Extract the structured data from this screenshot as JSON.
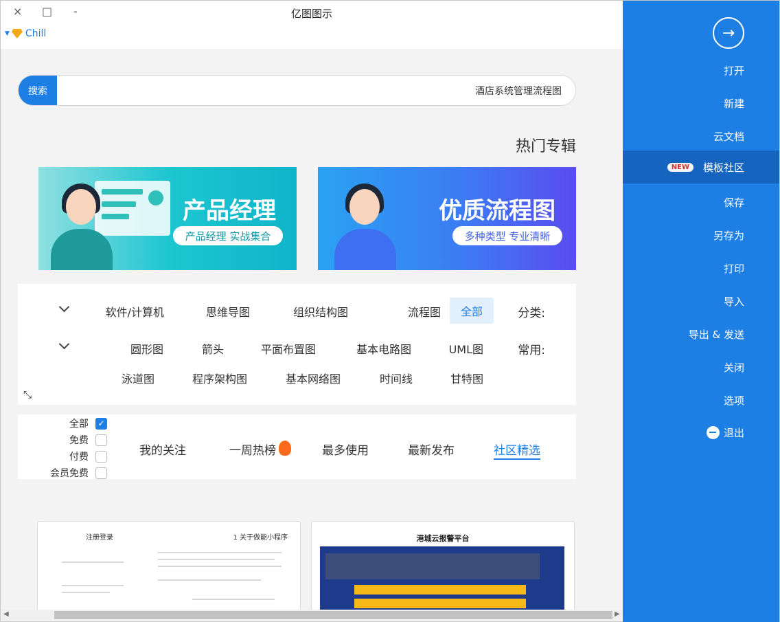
{
  "window": {
    "title": "亿图图示",
    "close_icon": "×",
    "maximize_icon": "□",
    "minimize_icon": "-"
  },
  "user": {
    "name": "Chill"
  },
  "search": {
    "button_label": "搜索",
    "query": "酒店系统管理流程图"
  },
  "hot": {
    "title": "热门专辑",
    "banners": [
      {
        "title": "产品经理",
        "subtitle": "产品经理 实战集合"
      },
      {
        "title": "优质流程图",
        "subtitle": "多种类型 专业清晰"
      }
    ]
  },
  "filters": {
    "category_label": "分类:",
    "categories": [
      "全部",
      "流程图",
      "组织结构图",
      "思维导图",
      "软件/计算机"
    ],
    "common_label": "常用:",
    "common_row1": [
      "UML图",
      "基本电路图",
      "平面布置图",
      "箭头",
      "圆形图"
    ],
    "common_row2": [
      "甘特图",
      "时间线",
      "基本网络图",
      "程序架构图",
      "泳道图"
    ],
    "expand_icon": "⤡"
  },
  "tabs": {
    "items": [
      "社区精选",
      "最新发布",
      "最多使用",
      "一周热榜",
      "我的关注"
    ],
    "active": "社区精选",
    "checkboxes": [
      {
        "label": "全部",
        "checked": true
      },
      {
        "label": "免费",
        "checked": false
      },
      {
        "label": "付费",
        "checked": false
      },
      {
        "label": "会员免费",
        "checked": false
      }
    ]
  },
  "cards": [
    {
      "title": "1 关于做能小程序",
      "side_title": "注册登录"
    },
    {
      "title": "港城云报警平台"
    }
  ],
  "sidebar": {
    "back_icon": "→",
    "items": [
      {
        "label": "打开"
      },
      {
        "label": "新建"
      },
      {
        "label": "云文档"
      },
      {
        "label": "模板社区",
        "badge": "NEW"
      },
      {
        "label": "保存"
      },
      {
        "label": "另存为"
      },
      {
        "label": "打印"
      },
      {
        "label": "导入"
      },
      {
        "label": "导出 & 发送"
      },
      {
        "label": "关闭"
      },
      {
        "label": "选项"
      },
      {
        "label": "退出"
      }
    ]
  },
  "colors": {
    "accent": "#1d7ee3",
    "sidebar_active": "#1565c0",
    "badge": "#e02d2d"
  }
}
